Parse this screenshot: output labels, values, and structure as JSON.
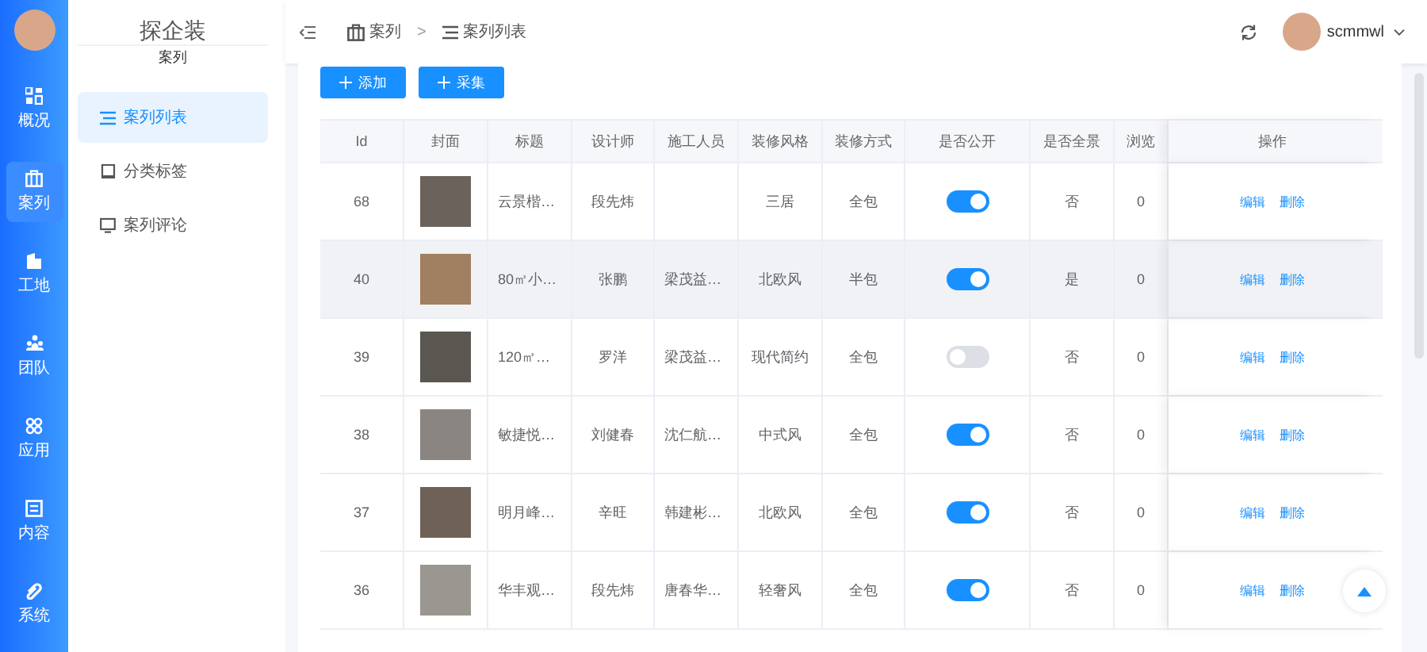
{
  "rail": [
    {
      "label": "概况",
      "selected": false
    },
    {
      "label": "案列",
      "selected": true
    },
    {
      "label": "工地",
      "selected": false
    },
    {
      "label": "团队",
      "selected": false
    },
    {
      "label": "应用",
      "selected": false
    },
    {
      "label": "内容",
      "selected": false
    },
    {
      "label": "系统",
      "selected": false
    }
  ],
  "sidebar": {
    "title": "探企装",
    "subtitle": "案列",
    "items": [
      {
        "label": "案列列表",
        "selected": true
      },
      {
        "label": "分类标签",
        "selected": false
      },
      {
        "label": "案列评论",
        "selected": false
      }
    ]
  },
  "breadcrumb": [
    {
      "label": "案列"
    },
    {
      "label": "案列列表"
    }
  ],
  "breadcrumb_separator": ">",
  "user": {
    "name": "scmmwl"
  },
  "buttons": [
    {
      "label": "添加"
    },
    {
      "label": "采集"
    }
  ],
  "table": {
    "columns": [
      "Id",
      "封面",
      "标题",
      "设计师",
      "施工人员",
      "装修风格",
      "装修方式",
      "是否公开",
      "是否全景",
      "浏览",
      "操作"
    ],
    "rows": [
      {
        "id": "68",
        "title": "云景楷…",
        "designer": "段先炜",
        "builder": "",
        "style": "三居",
        "mode": "全包",
        "public": true,
        "panorama": "否",
        "views": "0",
        "highlighted": false,
        "actions": [
          "编辑",
          "删除"
        ]
      },
      {
        "id": "40",
        "title": "80㎡小…",
        "designer": "张鹏",
        "builder": "梁茂益…",
        "style": "北欧风",
        "mode": "半包",
        "public": true,
        "panorama": "是",
        "views": "0",
        "highlighted": true,
        "actions": [
          "编辑",
          "删除"
        ]
      },
      {
        "id": "39",
        "title": "120㎡…",
        "designer": "罗洋",
        "builder": "梁茂益…",
        "style": "现代简约",
        "mode": "全包",
        "public": false,
        "panorama": "否",
        "views": "0",
        "highlighted": false,
        "actions": [
          "编辑",
          "删除"
        ]
      },
      {
        "id": "38",
        "title": "敏捷悦…",
        "designer": "刘健春",
        "builder": "沈仁航…",
        "style": "中式风",
        "mode": "全包",
        "public": true,
        "panorama": "否",
        "views": "0",
        "highlighted": false,
        "actions": [
          "编辑",
          "删除"
        ]
      },
      {
        "id": "37",
        "title": "明月峰…",
        "designer": "辛旺",
        "builder": "韩建彬…",
        "style": "北欧风",
        "mode": "全包",
        "public": true,
        "panorama": "否",
        "views": "0",
        "highlighted": false,
        "actions": [
          "编辑",
          "删除"
        ]
      },
      {
        "id": "36",
        "title": "华丰观…",
        "designer": "段先炜",
        "builder": "唐春华…",
        "style": "轻奢风",
        "mode": "全包",
        "public": true,
        "panorama": "否",
        "views": "0",
        "highlighted": false,
        "actions": [
          "编辑",
          "删除"
        ]
      }
    ]
  }
}
